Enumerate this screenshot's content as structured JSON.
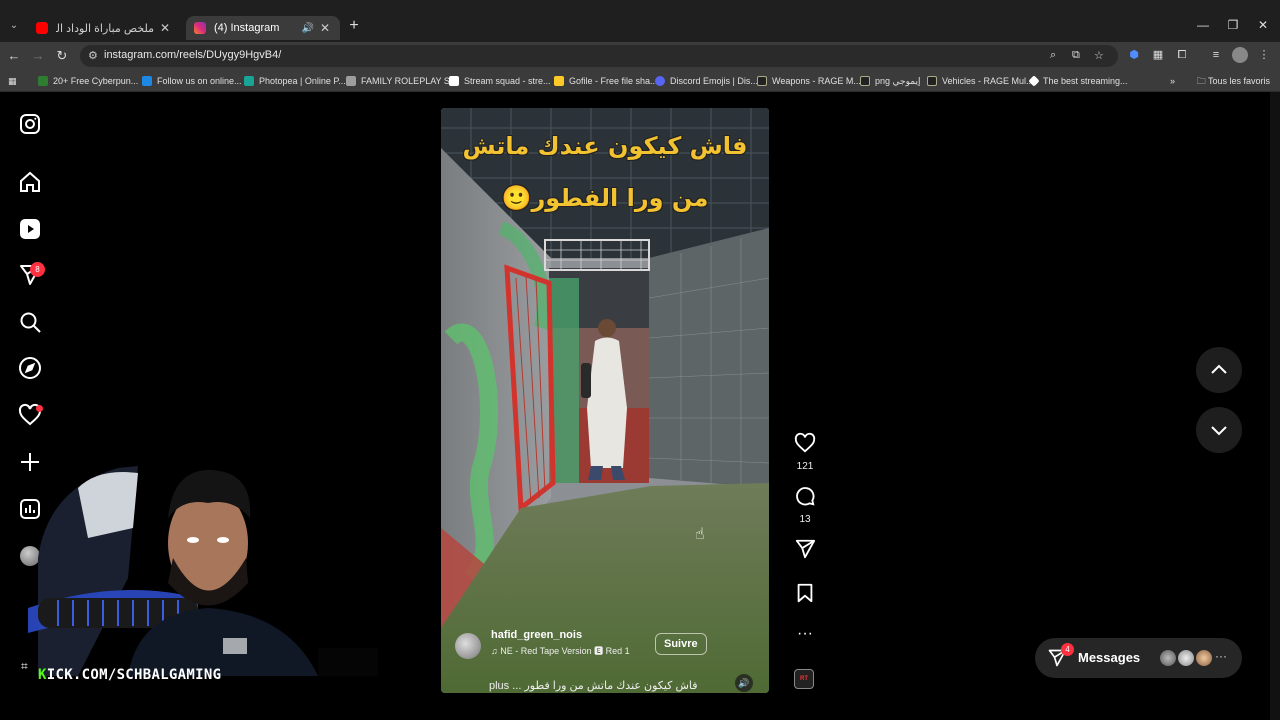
{
  "browser": {
    "tabs": [
      {
        "title": "ملخص مباراة الوداد المغربي وعزا",
        "active": false,
        "favicon_color": "#ff0000"
      },
      {
        "title": "(4) Instagram",
        "active": true,
        "favicon_color": "#e1306c",
        "audio": true
      }
    ],
    "url": "instagram.com/reels/DUygy9HgvB4/",
    "bookmarks": [
      {
        "label": "20+ Free Cyberpun...",
        "color": "#2e7d32"
      },
      {
        "label": "Follow us on online...",
        "color": "#1e88e5"
      },
      {
        "label": "Photopea | Online P...",
        "color": "#18a497"
      },
      {
        "label": "FAMILY ROLEPLAY S...",
        "color": "#9e9e9e"
      },
      {
        "label": "Stream squad - stre...",
        "color": "#ffffff"
      },
      {
        "label": "Gofile - Free file sha...",
        "color": "#ffca28"
      },
      {
        "label": "Discord Emojis | Dis...",
        "color": "#5865f2"
      },
      {
        "label": "Weapons - RAGE M...",
        "color": "#222222"
      },
      {
        "label": "png إيموجي",
        "color": "#222222"
      },
      {
        "label": "Vehicles - RAGE Mul...",
        "color": "#222222"
      },
      {
        "label": "The best streaming...",
        "color": "#ffffff"
      }
    ],
    "all_bookmarks": "Tous les favoris"
  },
  "sidebar": {
    "notification_count": "8",
    "icons": [
      "instagram-logo-icon",
      "home-icon",
      "reels-icon",
      "messages-icon",
      "search-icon",
      "explore-icon",
      "notifications-icon",
      "create-icon",
      "dashboard-icon",
      "profile-icon"
    ]
  },
  "reel": {
    "overlay_line1": "فاش كيكون عندك ماتش",
    "overlay_line2": "من ورا الفطور🙂",
    "username": "hafid_green_nois",
    "audio": "♫  NE - Red Tape Version  🅴  Red 1",
    "follow_label": "Suivre",
    "caption": "plus ... فاش كيكون عندك ماتش من ورا فطور",
    "likes": "121",
    "comments": "13",
    "audio_thumb_label": "RT"
  },
  "messages": {
    "label": "Messages",
    "badge": "4"
  },
  "overlay": {
    "prefix": "K",
    "rest": "ICK.COM/SCHBALGAMING"
  },
  "colors": {
    "accent": "#ff3040",
    "kick_green": "#53fc18"
  }
}
